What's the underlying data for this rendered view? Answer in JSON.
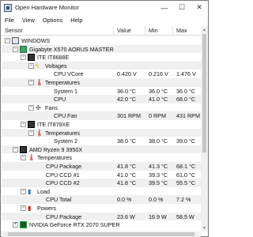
{
  "window": {
    "title": "Open Hardware Monitor",
    "buttons": {
      "minimize": "—",
      "maximize": "☐",
      "close": "✕"
    }
  },
  "menu": [
    "File",
    "View",
    "Options",
    "Help"
  ],
  "columns": {
    "sensor": "Sensor",
    "value": "Value",
    "min": "Min",
    "max": "Max"
  },
  "rows": [
    {
      "label": "WINDOWS",
      "value": "",
      "min": "",
      "max": ""
    },
    {
      "label": "Gigabyte X570 AORUS MASTER",
      "value": "",
      "min": "",
      "max": ""
    },
    {
      "label": "ITE IT8688E",
      "value": "",
      "min": "",
      "max": ""
    },
    {
      "label": "Voltages",
      "value": "",
      "min": "",
      "max": ""
    },
    {
      "label": "CPU VCore",
      "value": "0.420 V",
      "min": "0.216 V",
      "max": "1.476 V"
    },
    {
      "label": "Temperatures",
      "value": "",
      "min": "",
      "max": ""
    },
    {
      "label": "System 1",
      "value": "36.0 °C",
      "min": "36.0 °C",
      "max": "36.0 °C"
    },
    {
      "label": "CPU",
      "value": "42.0 °C",
      "min": "41.0 °C",
      "max": "68.0 °C"
    },
    {
      "label": "Fans",
      "value": "",
      "min": "",
      "max": ""
    },
    {
      "label": "CPU Fan",
      "value": "301 RPM",
      "min": "0 RPM",
      "max": "431 RPM"
    },
    {
      "label": "ITE IT879XE",
      "value": "",
      "min": "",
      "max": ""
    },
    {
      "label": "Temperatures",
      "value": "",
      "min": "",
      "max": ""
    },
    {
      "label": "System 2",
      "value": "38.0 °C",
      "min": "38.0 °C",
      "max": "39.0 °C"
    },
    {
      "label": "AMD Ryzen 9 3950X",
      "value": "",
      "min": "",
      "max": ""
    },
    {
      "label": "Temperatures",
      "value": "",
      "min": "",
      "max": ""
    },
    {
      "label": "CPU Package",
      "value": "41.8 °C",
      "min": "41.3 °C",
      "max": "68.1 °C"
    },
    {
      "label": "CPU CCD #1",
      "value": "41.0 °C",
      "min": "39.3 °C",
      "max": "61.0 °C"
    },
    {
      "label": "CPU CCD #2",
      "value": "41.8 °C",
      "min": "39.5 °C",
      "max": "55.5 °C"
    },
    {
      "label": "Load",
      "value": "",
      "min": "",
      "max": ""
    },
    {
      "label": "CPU Total",
      "value": "0.0 %",
      "min": "0.0 %",
      "max": "7.2 %"
    },
    {
      "label": "Powers",
      "value": "",
      "min": "",
      "max": ""
    },
    {
      "label": "CPU Package",
      "value": "23.6 W",
      "min": "16.9 W",
      "max": "58.5 W"
    },
    {
      "label": "NVIDIA GeForce RTX 2070 SUPER",
      "value": "",
      "min": "",
      "max": ""
    }
  ]
}
